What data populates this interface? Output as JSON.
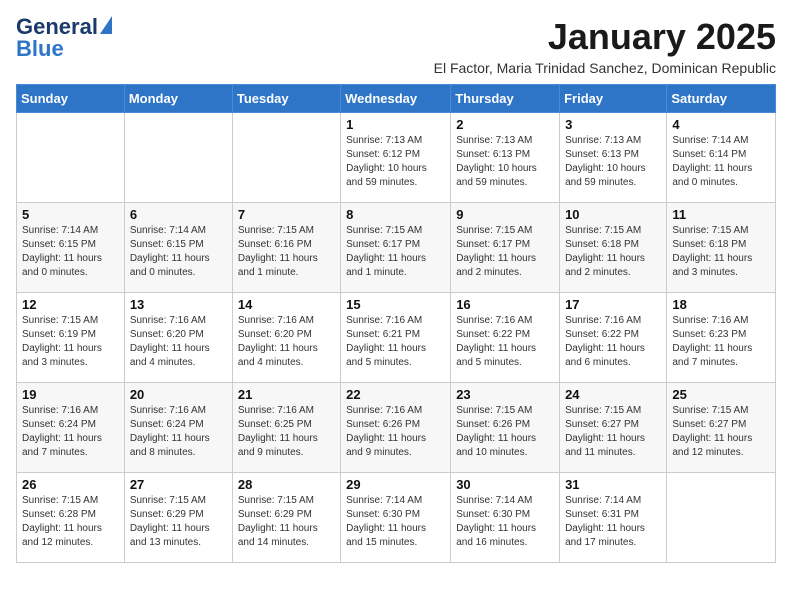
{
  "logo": {
    "line1": "General",
    "line2": "Blue"
  },
  "title": "January 2025",
  "subtitle": "El Factor, Maria Trinidad Sanchez, Dominican Republic",
  "weekdays": [
    "Sunday",
    "Monday",
    "Tuesday",
    "Wednesday",
    "Thursday",
    "Friday",
    "Saturday"
  ],
  "weeks": [
    [
      {
        "day": "",
        "info": ""
      },
      {
        "day": "",
        "info": ""
      },
      {
        "day": "",
        "info": ""
      },
      {
        "day": "1",
        "info": "Sunrise: 7:13 AM\nSunset: 6:12 PM\nDaylight: 10 hours and 59 minutes."
      },
      {
        "day": "2",
        "info": "Sunrise: 7:13 AM\nSunset: 6:13 PM\nDaylight: 10 hours and 59 minutes."
      },
      {
        "day": "3",
        "info": "Sunrise: 7:13 AM\nSunset: 6:13 PM\nDaylight: 10 hours and 59 minutes."
      },
      {
        "day": "4",
        "info": "Sunrise: 7:14 AM\nSunset: 6:14 PM\nDaylight: 11 hours and 0 minutes."
      }
    ],
    [
      {
        "day": "5",
        "info": "Sunrise: 7:14 AM\nSunset: 6:15 PM\nDaylight: 11 hours and 0 minutes."
      },
      {
        "day": "6",
        "info": "Sunrise: 7:14 AM\nSunset: 6:15 PM\nDaylight: 11 hours and 0 minutes."
      },
      {
        "day": "7",
        "info": "Sunrise: 7:15 AM\nSunset: 6:16 PM\nDaylight: 11 hours and 1 minute."
      },
      {
        "day": "8",
        "info": "Sunrise: 7:15 AM\nSunset: 6:17 PM\nDaylight: 11 hours and 1 minute."
      },
      {
        "day": "9",
        "info": "Sunrise: 7:15 AM\nSunset: 6:17 PM\nDaylight: 11 hours and 2 minutes."
      },
      {
        "day": "10",
        "info": "Sunrise: 7:15 AM\nSunset: 6:18 PM\nDaylight: 11 hours and 2 minutes."
      },
      {
        "day": "11",
        "info": "Sunrise: 7:15 AM\nSunset: 6:18 PM\nDaylight: 11 hours and 3 minutes."
      }
    ],
    [
      {
        "day": "12",
        "info": "Sunrise: 7:15 AM\nSunset: 6:19 PM\nDaylight: 11 hours and 3 minutes."
      },
      {
        "day": "13",
        "info": "Sunrise: 7:16 AM\nSunset: 6:20 PM\nDaylight: 11 hours and 4 minutes."
      },
      {
        "day": "14",
        "info": "Sunrise: 7:16 AM\nSunset: 6:20 PM\nDaylight: 11 hours and 4 minutes."
      },
      {
        "day": "15",
        "info": "Sunrise: 7:16 AM\nSunset: 6:21 PM\nDaylight: 11 hours and 5 minutes."
      },
      {
        "day": "16",
        "info": "Sunrise: 7:16 AM\nSunset: 6:22 PM\nDaylight: 11 hours and 5 minutes."
      },
      {
        "day": "17",
        "info": "Sunrise: 7:16 AM\nSunset: 6:22 PM\nDaylight: 11 hours and 6 minutes."
      },
      {
        "day": "18",
        "info": "Sunrise: 7:16 AM\nSunset: 6:23 PM\nDaylight: 11 hours and 7 minutes."
      }
    ],
    [
      {
        "day": "19",
        "info": "Sunrise: 7:16 AM\nSunset: 6:24 PM\nDaylight: 11 hours and 7 minutes."
      },
      {
        "day": "20",
        "info": "Sunrise: 7:16 AM\nSunset: 6:24 PM\nDaylight: 11 hours and 8 minutes."
      },
      {
        "day": "21",
        "info": "Sunrise: 7:16 AM\nSunset: 6:25 PM\nDaylight: 11 hours and 9 minutes."
      },
      {
        "day": "22",
        "info": "Sunrise: 7:16 AM\nSunset: 6:26 PM\nDaylight: 11 hours and 9 minutes."
      },
      {
        "day": "23",
        "info": "Sunrise: 7:15 AM\nSunset: 6:26 PM\nDaylight: 11 hours and 10 minutes."
      },
      {
        "day": "24",
        "info": "Sunrise: 7:15 AM\nSunset: 6:27 PM\nDaylight: 11 hours and 11 minutes."
      },
      {
        "day": "25",
        "info": "Sunrise: 7:15 AM\nSunset: 6:27 PM\nDaylight: 11 hours and 12 minutes."
      }
    ],
    [
      {
        "day": "26",
        "info": "Sunrise: 7:15 AM\nSunset: 6:28 PM\nDaylight: 11 hours and 12 minutes."
      },
      {
        "day": "27",
        "info": "Sunrise: 7:15 AM\nSunset: 6:29 PM\nDaylight: 11 hours and 13 minutes."
      },
      {
        "day": "28",
        "info": "Sunrise: 7:15 AM\nSunset: 6:29 PM\nDaylight: 11 hours and 14 minutes."
      },
      {
        "day": "29",
        "info": "Sunrise: 7:14 AM\nSunset: 6:30 PM\nDaylight: 11 hours and 15 minutes."
      },
      {
        "day": "30",
        "info": "Sunrise: 7:14 AM\nSunset: 6:30 PM\nDaylight: 11 hours and 16 minutes."
      },
      {
        "day": "31",
        "info": "Sunrise: 7:14 AM\nSunset: 6:31 PM\nDaylight: 11 hours and 17 minutes."
      },
      {
        "day": "",
        "info": ""
      }
    ]
  ]
}
